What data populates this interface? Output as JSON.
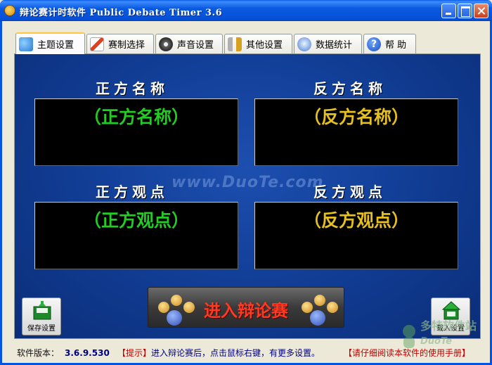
{
  "window": {
    "title": "辩论赛计时软件 Public Debate Timer 3.6"
  },
  "tabs": [
    {
      "label": "主题设置",
      "icon": "theme-icon",
      "active": true
    },
    {
      "label": "赛制选择",
      "icon": "pen-icon",
      "active": false
    },
    {
      "label": "声音设置",
      "icon": "speaker-icon",
      "active": false
    },
    {
      "label": "其他设置",
      "icon": "tools-icon",
      "active": false
    },
    {
      "label": "数据统计",
      "icon": "stats-icon",
      "active": false
    },
    {
      "label": "帮  助",
      "icon": "help-icon",
      "active": false
    }
  ],
  "affirmative": {
    "name_heading": "正方名称",
    "name_value": "（正方名称）",
    "view_heading": "正方观点",
    "view_value": "（正方观点）",
    "color": "#22cc22"
  },
  "negative": {
    "name_heading": "反方名称",
    "name_value": "（反方名称）",
    "view_heading": "反方观点",
    "view_value": "（反方观点）",
    "color": "#e6c020"
  },
  "watermark": "www.DuoTe.com",
  "enter_button": "进入辩论赛",
  "save_button": "保存设置",
  "load_button": "载入设置",
  "status": {
    "version_label": "软件版本：",
    "version_value": "3.6.9.530",
    "tip_bracket": "【提示】",
    "tip_text": "进入辩论赛后，点击鼠标右键，有更多设置。",
    "notice": "【请仔细阅读本软件的使用手册】"
  },
  "corner_logo": "多特软件站"
}
